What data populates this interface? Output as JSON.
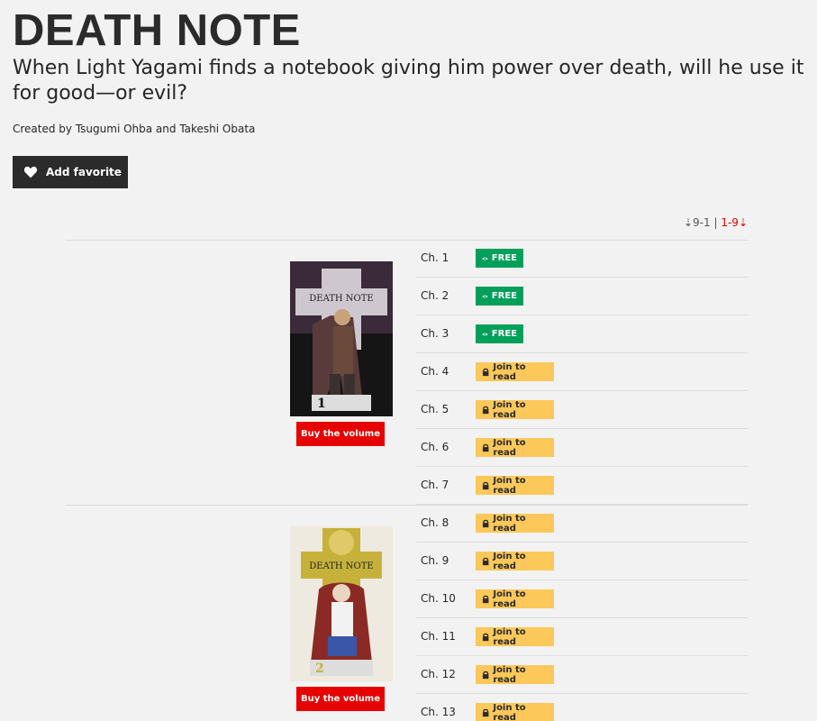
{
  "series": {
    "title": "DEATH NOTE",
    "tagline": "When Light Yagami finds a notebook giving him power over death, will he use it for good—or evil?",
    "creators": "Created by Tsugumi Ohba and Takeshi Obata",
    "favorite_label": "Add favorite"
  },
  "sort": {
    "desc_label": "⇣9-1",
    "separator": "|",
    "asc_label": "1-9⇣"
  },
  "volumes": [
    {
      "buy_label": "Buy the volume",
      "cover_logo": "DEATH NOTE",
      "number": "1"
    },
    {
      "buy_label": "Buy the volume",
      "cover_logo": "DEATH NOTE",
      "number": "2"
    }
  ],
  "chapters": [
    {
      "label": "Ch. 1",
      "status": "FREE",
      "type": "free"
    },
    {
      "label": "Ch. 2",
      "status": "FREE",
      "type": "free"
    },
    {
      "label": "Ch. 3",
      "status": "FREE",
      "type": "free"
    },
    {
      "label": "Ch. 4",
      "status": "Join to read",
      "type": "join"
    },
    {
      "label": "Ch. 5",
      "status": "Join to read",
      "type": "join"
    },
    {
      "label": "Ch. 6",
      "status": "Join to read",
      "type": "join"
    },
    {
      "label": "Ch. 7",
      "status": "Join to read",
      "type": "join"
    },
    {
      "label": "Ch. 8",
      "status": "Join to read",
      "type": "join"
    },
    {
      "label": "Ch. 9",
      "status": "Join to read",
      "type": "join"
    },
    {
      "label": "Ch. 10",
      "status": "Join to read",
      "type": "join"
    },
    {
      "label": "Ch. 11",
      "status": "Join to read",
      "type": "join"
    },
    {
      "label": "Ch. 12",
      "status": "Join to read",
      "type": "join"
    },
    {
      "label": "Ch. 13",
      "status": "Join to read",
      "type": "join"
    }
  ],
  "colors": {
    "free": "#00a05a",
    "join": "#fcc85a",
    "buy": "#e60000",
    "dark": "#2b2b2b"
  },
  "icons": {
    "favorite": "heart-icon",
    "free": "eye-icon",
    "join": "lock-icon"
  }
}
